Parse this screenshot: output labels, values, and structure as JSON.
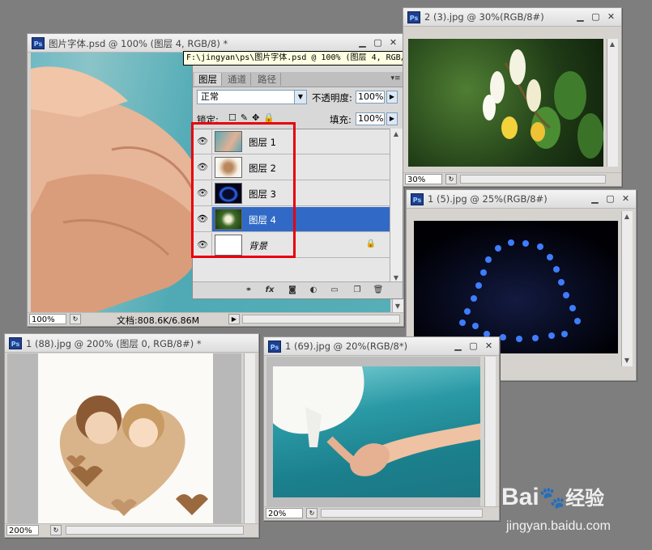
{
  "windows": {
    "main": {
      "title": "图片字体.psd @ 100% (图层 4, RGB/8) *",
      "tooltip": "F:\\jingyan\\ps\\图片字体.psd @ 100% (图层 4, RGB/8) *",
      "zoom": "100%",
      "doc_info": "文档:808.6K/6.86M"
    },
    "top_right": {
      "title": "2 (3).jpg @ 30%(RGB/8#)",
      "zoom": "30%"
    },
    "mid_right": {
      "title": "1 (5).jpg @ 25%(RGB/8#)"
    },
    "bottom_left": {
      "title": "1 (88).jpg @ 200% (图层 0, RGB/8#) *",
      "zoom": "200%"
    },
    "bottom_mid": {
      "title": "1 (69).jpg @ 20%(RGB/8*)",
      "zoom": "20%"
    }
  },
  "layers_panel": {
    "tabs": [
      "图层",
      "通道",
      "路径"
    ],
    "blend_mode": "正常",
    "opacity_label": "不透明度:",
    "opacity": "100%",
    "lock_label": "锁定:",
    "fill_label": "填充:",
    "fill": "100%",
    "layers": [
      {
        "name": "图层 1",
        "selected": false
      },
      {
        "name": "图层 2",
        "selected": false
      },
      {
        "name": "图层 3",
        "selected": false
      },
      {
        "name": "图层 4",
        "selected": true
      },
      {
        "name": "背景",
        "selected": false,
        "locked": true
      }
    ],
    "footer_icons": [
      "link-icon",
      "fx-icon",
      "mask-icon",
      "adjustment-icon",
      "folder-icon",
      "new-layer-icon",
      "trash-icon"
    ]
  },
  "watermark": {
    "brand": "Bai",
    "brand2": "经验",
    "url": "jingyan.baidu.com"
  },
  "colors": {
    "highlight": "#3169c6",
    "annotation": "#e8000c",
    "workspace": "#7e7e7e"
  }
}
